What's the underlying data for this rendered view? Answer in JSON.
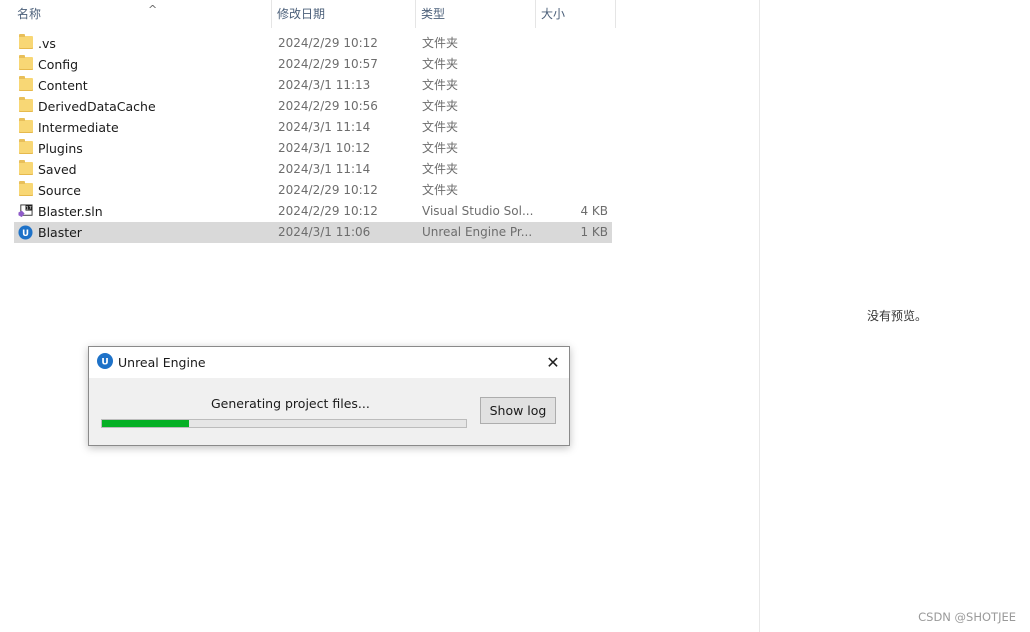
{
  "columns": {
    "name": "名称",
    "date": "修改日期",
    "type": "类型",
    "size": "大小",
    "sort_indicator": "^"
  },
  "files": [
    {
      "name": ".vs",
      "date": "2024/2/29 10:12",
      "type": "文件夹",
      "size": "",
      "icon": "folder-icon"
    },
    {
      "name": "Config",
      "date": "2024/2/29 10:57",
      "type": "文件夹",
      "size": "",
      "icon": "folder-icon"
    },
    {
      "name": "Content",
      "date": "2024/3/1 11:13",
      "type": "文件夹",
      "size": "",
      "icon": "folder-icon"
    },
    {
      "name": "DerivedDataCache",
      "date": "2024/2/29 10:56",
      "type": "文件夹",
      "size": "",
      "icon": "folder-icon"
    },
    {
      "name": "Intermediate",
      "date": "2024/3/1 11:14",
      "type": "文件夹",
      "size": "",
      "icon": "folder-icon"
    },
    {
      "name": "Plugins",
      "date": "2024/3/1 10:12",
      "type": "文件夹",
      "size": "",
      "icon": "folder-icon"
    },
    {
      "name": "Saved",
      "date": "2024/3/1 11:14",
      "type": "文件夹",
      "size": "",
      "icon": "folder-icon"
    },
    {
      "name": "Source",
      "date": "2024/2/29 10:12",
      "type": "文件夹",
      "size": "",
      "icon": "folder-icon"
    },
    {
      "name": "Blaster.sln",
      "date": "2024/2/29 10:12",
      "type": "Visual Studio Sol...",
      "size": "4 KB",
      "icon": "visual-studio-solution-icon"
    },
    {
      "name": "Blaster",
      "date": "2024/3/1 11:06",
      "type": "Unreal Engine Pr...",
      "size": "1 KB",
      "icon": "unreal-engine-icon",
      "selected": true
    }
  ],
  "preview": {
    "empty_text": "没有预览。"
  },
  "dialog": {
    "title": "Unreal Engine",
    "message": "Generating project files...",
    "progress_percent": 24,
    "show_log_label": "Show log",
    "close_glyph": "✕"
  },
  "watermark": "CSDN @SHOTJEE",
  "colors": {
    "progress_fill": "#06b025",
    "selection": "#d9d9d9",
    "folder": "#f8d775",
    "ue_blue": "#1e72c8"
  }
}
